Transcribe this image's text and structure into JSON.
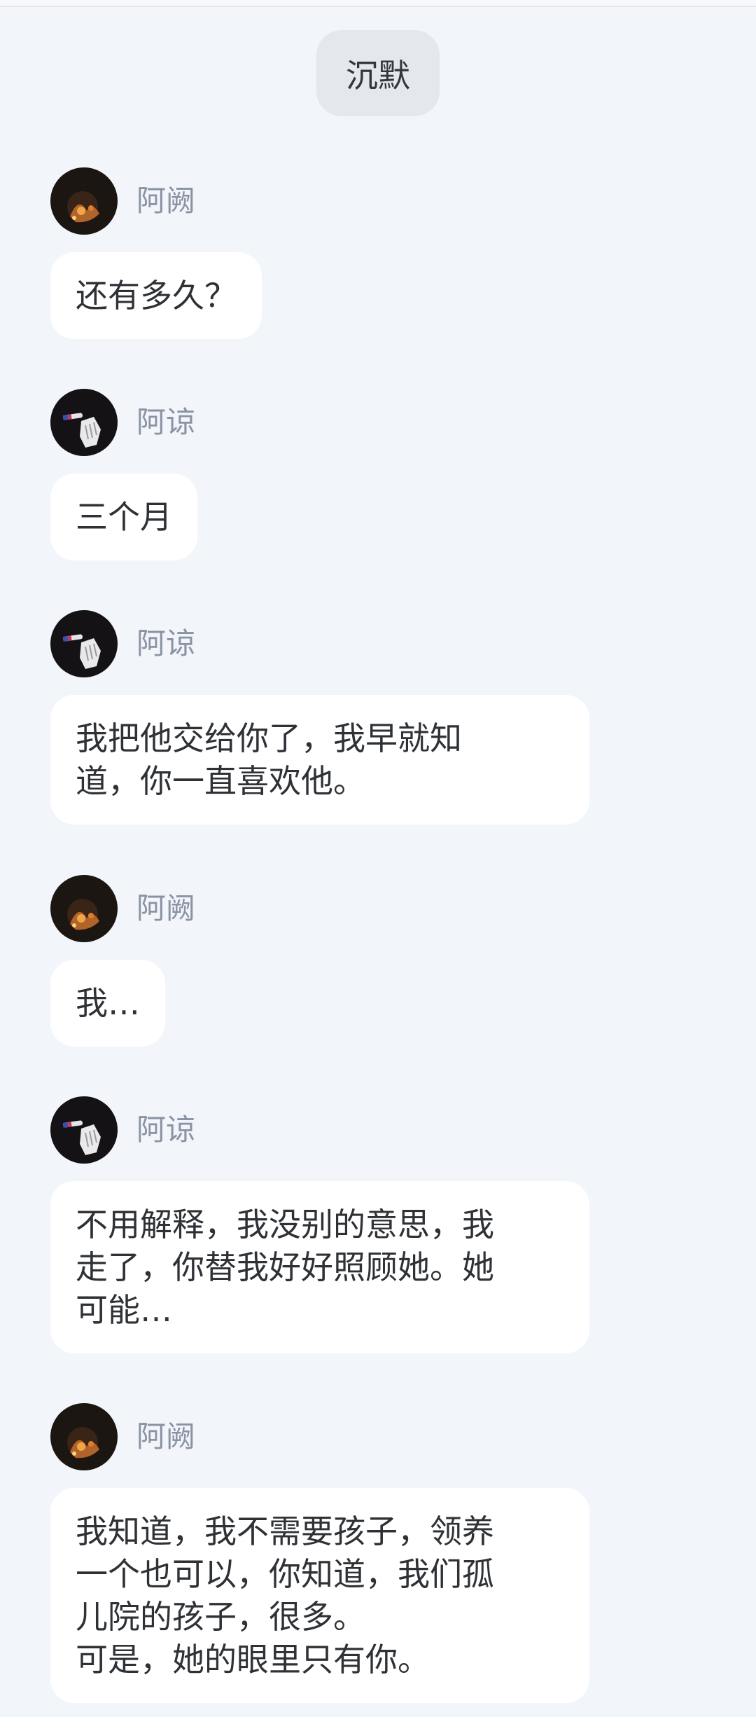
{
  "narration": {
    "text": "沉默"
  },
  "messages": [
    {
      "sender": "阿阙",
      "avatar": "ember-avatar-icon",
      "text": "还有多久？"
    },
    {
      "sender": "阿谅",
      "avatar": "hand-cigarette-avatar-icon",
      "text": "三个月"
    },
    {
      "sender": "阿谅",
      "avatar": "hand-cigarette-avatar-icon",
      "text": "我把他交给你了，我早就知\n道，你一直喜欢他。"
    },
    {
      "sender": "阿阙",
      "avatar": "ember-avatar-icon",
      "text": "我…"
    },
    {
      "sender": "阿谅",
      "avatar": "hand-cigarette-avatar-icon",
      "text": "不用解释，我没别的意思，我\n走了，你替我好好照顾她。她\n可能…"
    },
    {
      "sender": "阿阙",
      "avatar": "ember-avatar-icon",
      "text": "我知道，我不需要孩子，领养\n一个也可以，你知道，我们孤\n儿院的孩子，很多。\n可是，她的眼里只有你。"
    }
  ],
  "colors": {
    "background": "#f2f5fa",
    "bubble": "#ffffff",
    "sender_name": "#8a93a3",
    "narration_bg": "#e4e7ec"
  }
}
